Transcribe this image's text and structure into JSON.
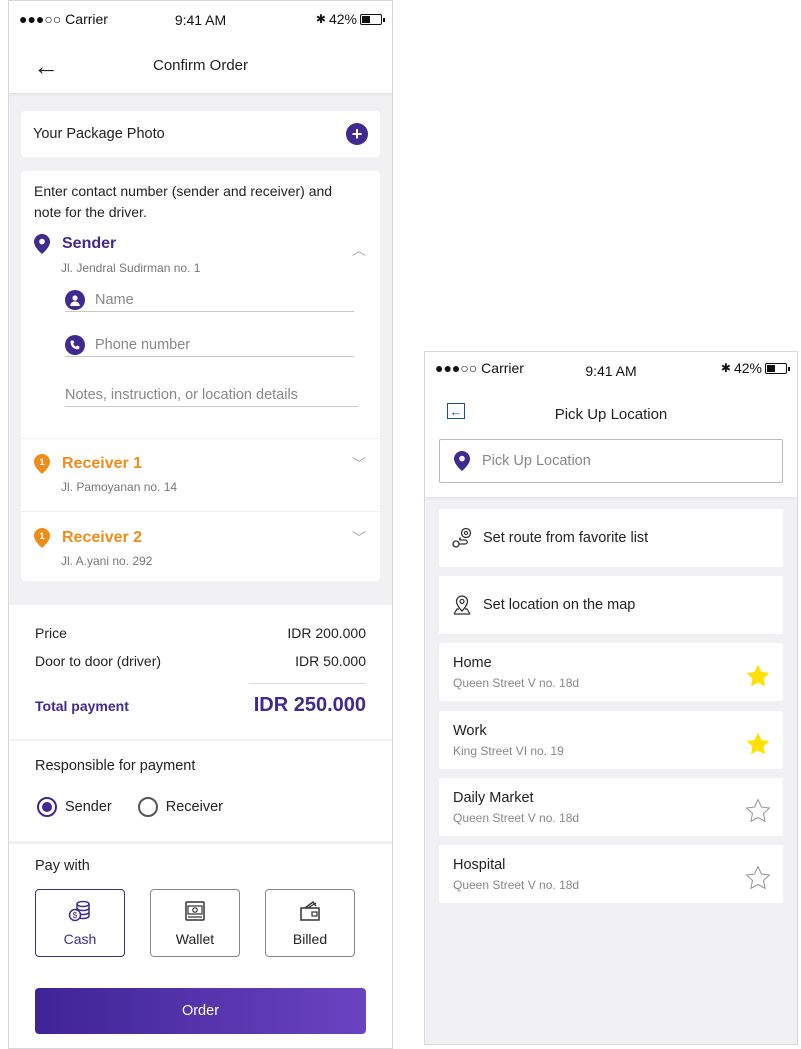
{
  "left_screen": {
    "status": {
      "carrier": "●●●○○ Carrier",
      "time": "9:41 AM",
      "battery": "42%"
    },
    "title": "Confirm Order",
    "package_photo_label": "Your Package Photo",
    "intro_text": "Enter contact number (sender and receiver) and note for the driver.",
    "sender": {
      "label": "Sender",
      "address": "Jl. Jendral Sudirman no. 1",
      "name_placeholder": "Name",
      "phone_placeholder": "Phone number",
      "notes_placeholder": "Notes, instruction, or location details"
    },
    "receivers": [
      {
        "badge": "1",
        "label": "Receiver 1",
        "address": "Jl. Pamoyanan no. 14"
      },
      {
        "badge": "1",
        "label": "Receiver 2",
        "address": "Jl. A.yani no. 292"
      }
    ],
    "pricing": {
      "price_label": "Price",
      "price_value": "IDR 200.000",
      "door_label": "Door to door (driver)",
      "door_value": "IDR 50.000",
      "total_label": "Total payment",
      "total_value": "IDR 250.000"
    },
    "responsibility": {
      "title": "Responsible for payment",
      "options": [
        "Sender",
        "Receiver"
      ],
      "selected": "Sender"
    },
    "pay_with": {
      "title": "Pay with",
      "options": [
        {
          "label": "Cash",
          "icon": "cash-coins-icon"
        },
        {
          "label": "Wallet",
          "icon": "wallet-icon"
        },
        {
          "label": "Billed",
          "icon": "billed-card-icon"
        }
      ],
      "selected": "Cash"
    },
    "order_button": "Order",
    "colors": {
      "primary": "#3f2a8f",
      "receiver": "#f08c1a",
      "gradient_end": "#6a43c2"
    }
  },
  "right_screen": {
    "status": {
      "carrier": "●●●○○ Carrier",
      "time": "9:41 AM",
      "battery": "42%"
    },
    "title": "Pick Up Location",
    "search_placeholder": "Pick Up Location",
    "actions": [
      {
        "label": "Set route from favorite list",
        "icon": "route-pins-icon"
      },
      {
        "label": "Set location on the map",
        "icon": "map-pin-icon"
      }
    ],
    "favorites": [
      {
        "name": "Home",
        "address": "Queen Street V no. 18d",
        "starred": true
      },
      {
        "name": "Work",
        "address": "King Street VI no. 19",
        "starred": true
      },
      {
        "name": "Daily Market",
        "address": "Queen Street V no. 18d",
        "starred": false
      },
      {
        "name": "Hospital",
        "address": "Queen Street V no. 18d",
        "starred": false
      }
    ],
    "colors": {
      "star_filled": "#ffe000",
      "star_outline": "#9a9a9a"
    }
  }
}
